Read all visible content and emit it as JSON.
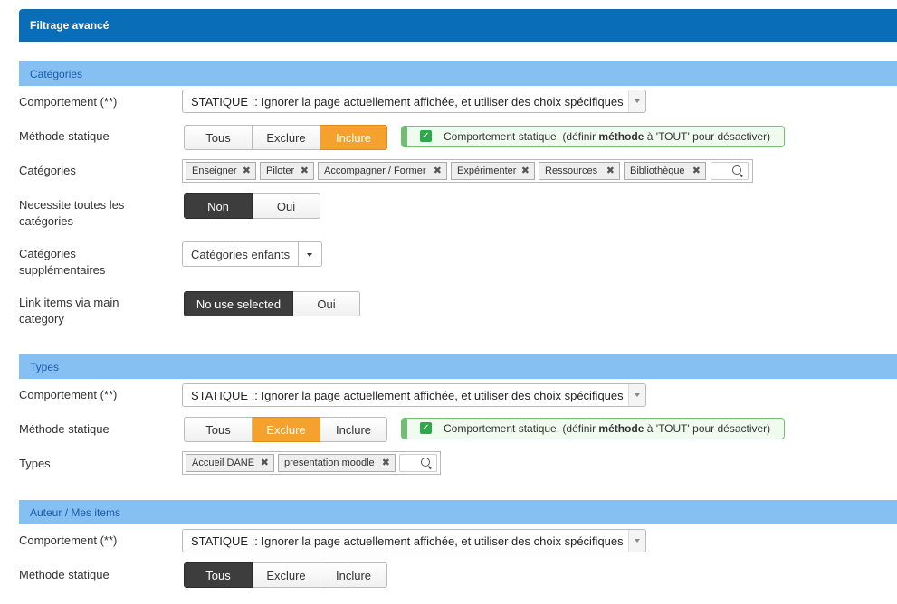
{
  "header": {
    "title": "Filtrage avancé"
  },
  "categories": {
    "section_title": "Catégories",
    "comportement_label": "Comportement (**)",
    "comportement_value": "STATIQUE :: Ignorer la page actuellement affichée, et utiliser des choix spécifiques",
    "methode_label": "Méthode statique",
    "methode_options": [
      "Tous",
      "Exclure",
      "Inclure"
    ],
    "methode_selected": "Inclure",
    "notice_pre": "Comportement statique, (définir ",
    "notice_bold": "méthode",
    "notice_post": " à 'TOUT' pour désactiver)",
    "categories_label": "Catégories",
    "tags": [
      "Enseigner",
      "Piloter",
      "Accompagner / Former",
      "Expérimenter",
      "Ressources",
      "Bibliothèque"
    ],
    "necessite_label_1": "Necessite toutes les",
    "necessite_label_2": "catégories",
    "necessite_options": [
      "Non",
      "Oui"
    ],
    "necessite_selected": "Non",
    "supp_label_1": "Catégories",
    "supp_label_2": "supplémentaires",
    "supp_value": "Catégories enfants",
    "link_label_1": "Link items via main",
    "link_label_2": "category",
    "link_options": [
      "No use selected",
      "Oui"
    ],
    "link_selected": "No use selected"
  },
  "types": {
    "section_title": "Types",
    "comportement_label": "Comportement (**)",
    "comportement_value": "STATIQUE :: Ignorer la page actuellement affichée, et utiliser des choix spécifiques",
    "methode_label": "Méthode statique",
    "methode_options": [
      "Tous",
      "Exclure",
      "Inclure"
    ],
    "methode_selected": "Exclure",
    "notice_pre": "Comportement statique, (définir ",
    "notice_bold": "méthode",
    "notice_post": " à 'TOUT' pour désactiver)",
    "types_label": "Types",
    "tags": [
      "Accueil DANE",
      "presentation moodle"
    ]
  },
  "auteur": {
    "section_title": "Auteur / Mes items",
    "comportement_label": "Comportement (**)",
    "comportement_value": "STATIQUE :: Ignorer la page actuellement affichée, et utiliser des choix spécifiques",
    "methode_label": "Méthode statique",
    "methode_options": [
      "Tous",
      "Exclure",
      "Inclure"
    ],
    "methode_selected": "Tous"
  },
  "colors": {
    "header_bg": "#0a6db8",
    "section_bg": "#86c0f3",
    "orange": "#f5a12d",
    "dark": "#3d3d3d",
    "success": "#6fbf6f"
  }
}
